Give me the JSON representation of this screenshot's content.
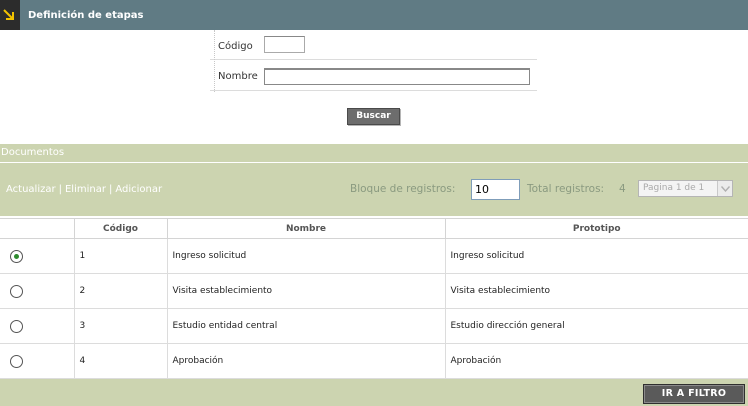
{
  "window": {
    "title": "Definición de etapas",
    "accent_color": "#607b84",
    "panel_color": "#ccd4b0"
  },
  "filter": {
    "codigo_label": "Código",
    "codigo_value": "",
    "nombre_label": "Nombre",
    "nombre_value": "",
    "buscar_label": "Buscar"
  },
  "documents": {
    "header": "Documentos",
    "actions": {
      "actualizar": "Actualizar",
      "eliminar": "Eliminar",
      "adicionar": "Adicionar",
      "separator": "|"
    },
    "bloque_label": "Bloque de registros:",
    "bloque_value": "10",
    "total_label": "Total registros:",
    "total_value": "4",
    "pager_label": "Pagina 1 de 1"
  },
  "table": {
    "columns": [
      "",
      "Código",
      "Nombre",
      "Prototipo"
    ],
    "rows": [
      {
        "selected": true,
        "codigo": "1",
        "nombre": "Ingreso solicitud",
        "prototipo": "Ingreso solicitud"
      },
      {
        "selected": false,
        "codigo": "2",
        "nombre": "Visita establecimiento",
        "prototipo": "Visita establecimiento"
      },
      {
        "selected": false,
        "codigo": "3",
        "nombre": "Estudio entidad central",
        "prototipo": "Estudio dirección general"
      },
      {
        "selected": false,
        "codigo": "4",
        "nombre": "Aprobación",
        "prototipo": "Aprobación"
      }
    ]
  },
  "footer": {
    "ir_a_filtro_label": "IR A FILTRO"
  }
}
